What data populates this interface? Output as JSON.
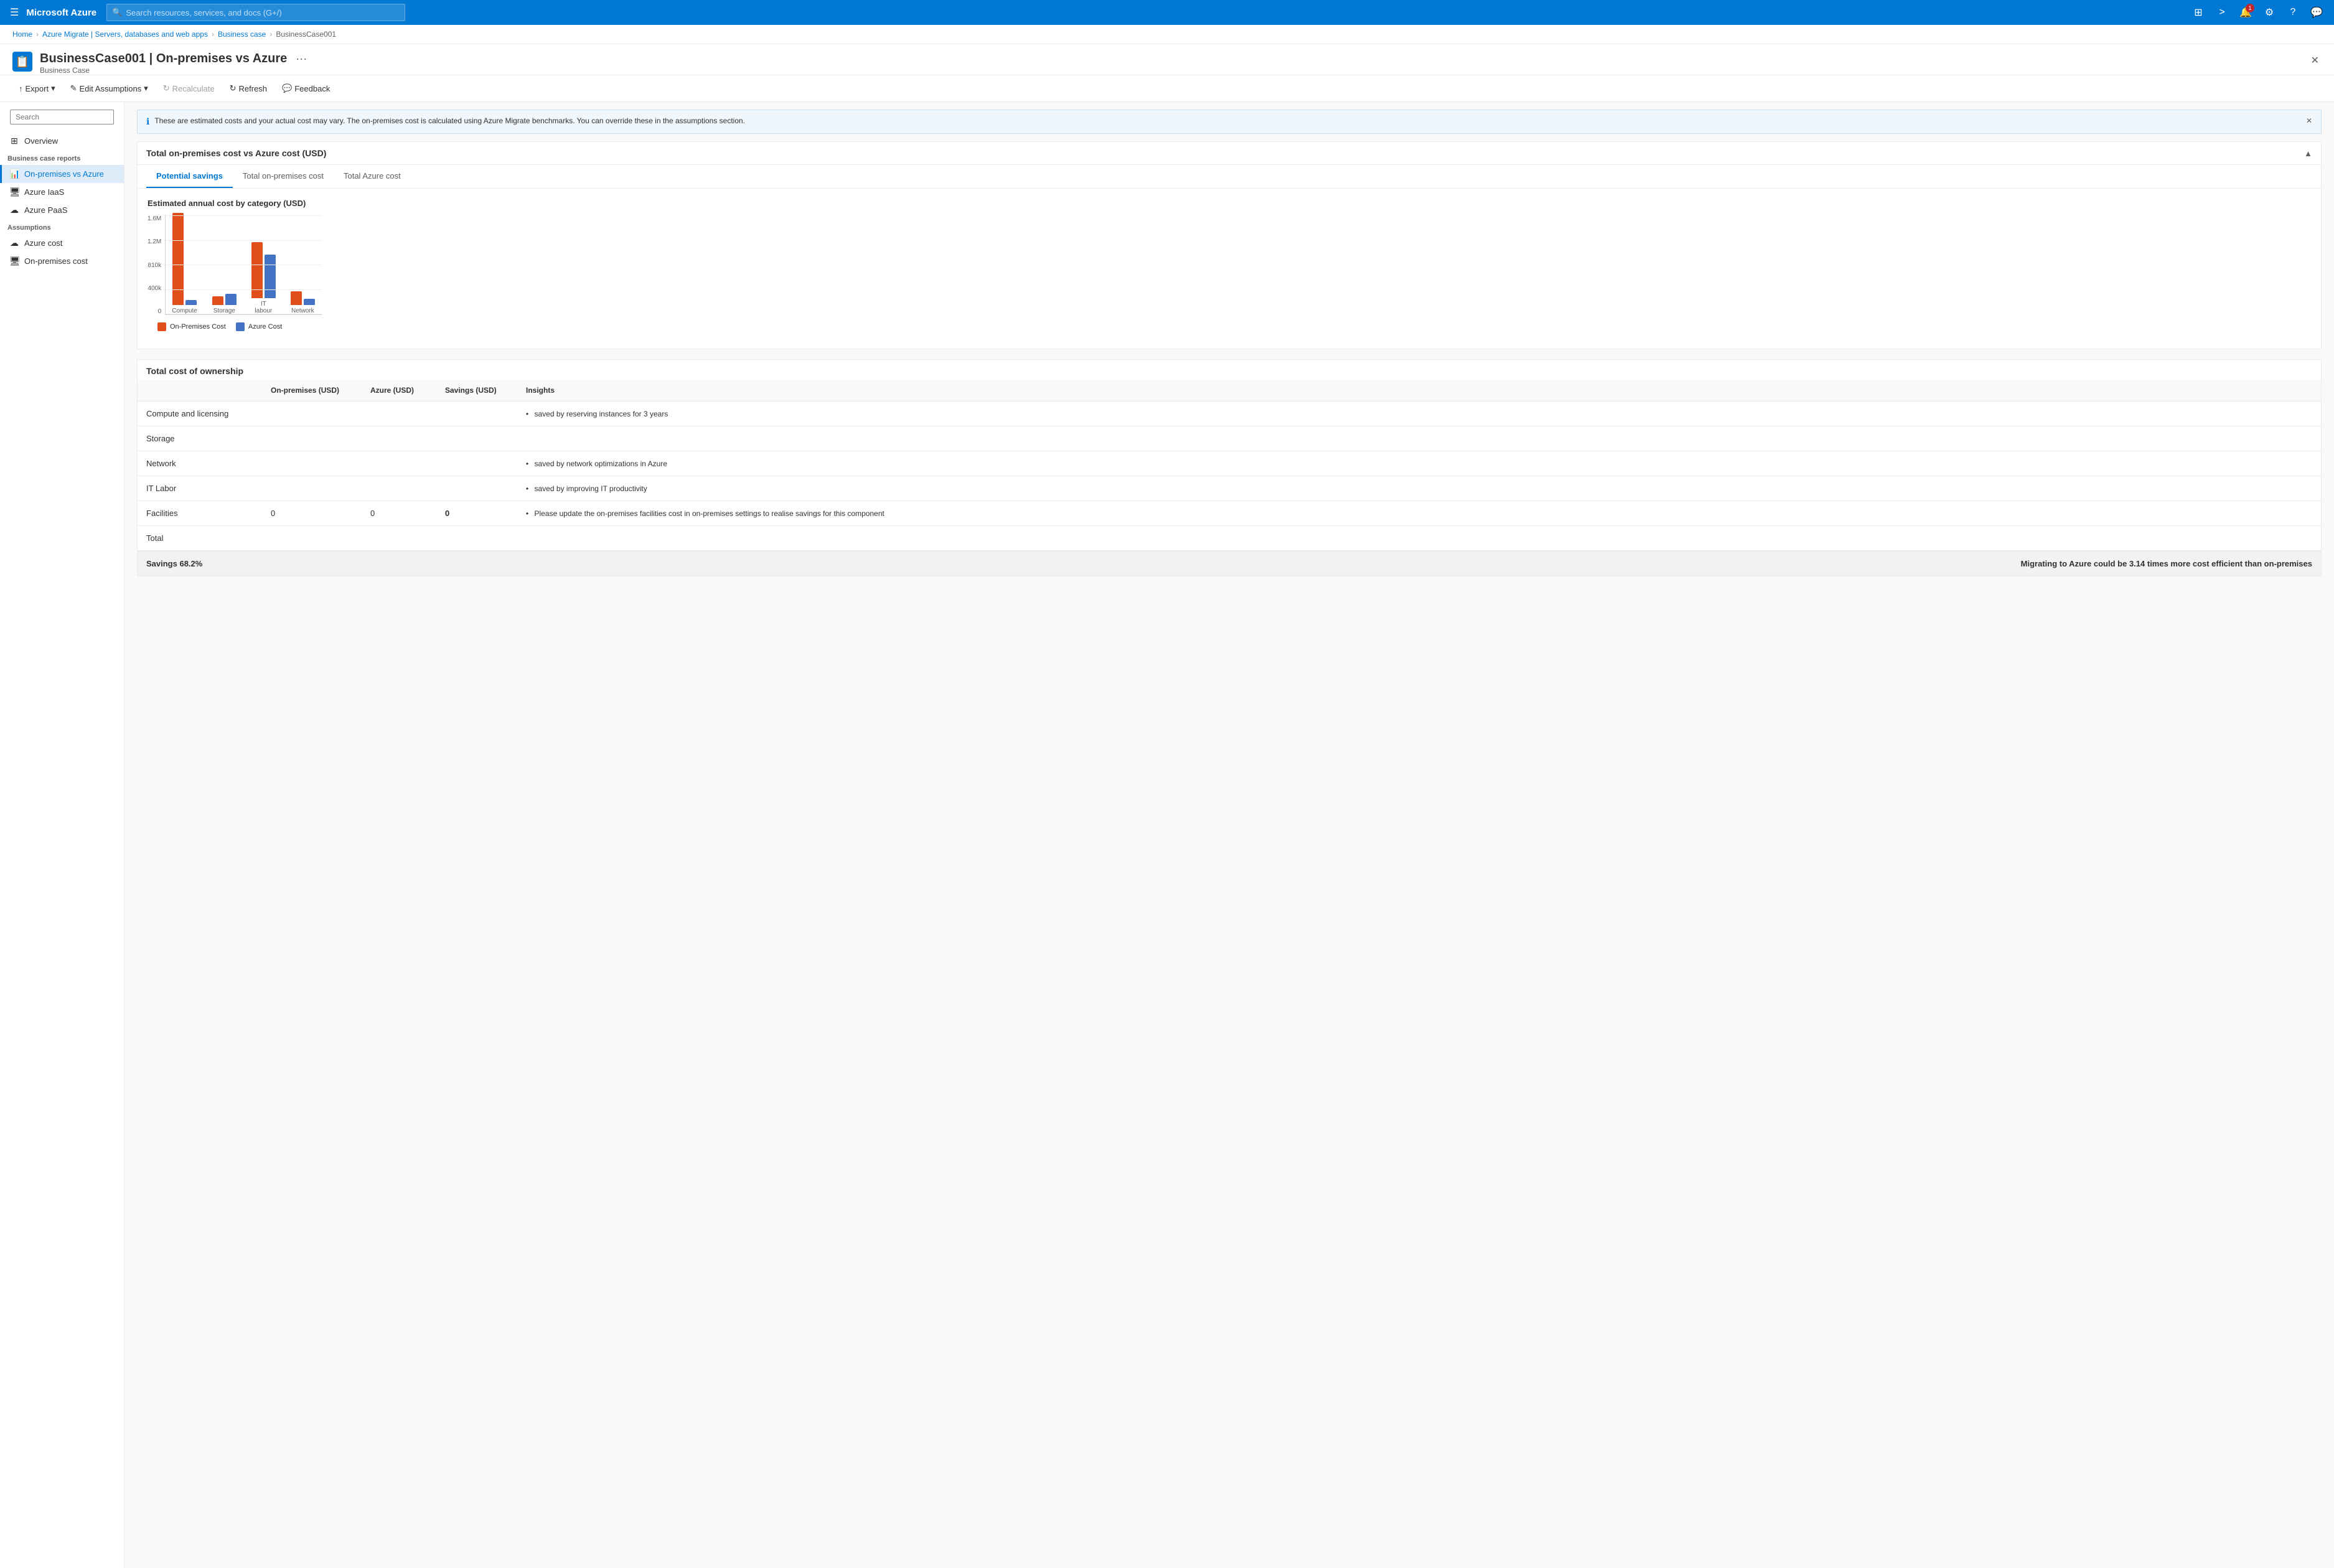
{
  "app": {
    "name": "Microsoft Azure"
  },
  "topnav": {
    "search_placeholder": "Search resources, services, and docs (G+/)",
    "icons": [
      "portal",
      "cloud-shell",
      "notifications",
      "settings",
      "help",
      "feedback"
    ]
  },
  "breadcrumb": {
    "items": [
      "Home",
      "Azure Migrate | Servers, databases and web apps",
      "Business case",
      "BusinessCase001"
    ]
  },
  "page": {
    "icon": "📋",
    "title": "BusinessCase001 | On-premises vs Azure",
    "subtitle": "Business Case"
  },
  "toolbar": {
    "export_label": "Export",
    "edit_assumptions_label": "Edit Assumptions",
    "recalculate_label": "Recalculate",
    "refresh_label": "Refresh",
    "feedback_label": "Feedback"
  },
  "info_banner": {
    "text": "These are estimated costs and your actual cost may vary. The on-premises cost is calculated using Azure Migrate benchmarks. You can override these in the assumptions section."
  },
  "section_title": "Total on-premises cost vs Azure cost (USD)",
  "tabs": {
    "items": [
      "Potential savings",
      "Total on-premises cost",
      "Total Azure cost"
    ]
  },
  "chart": {
    "title": "Estimated annual cost by category (USD)",
    "y_labels": [
      "1.6M",
      "1.2M",
      "810k",
      "400k",
      "0"
    ],
    "bar_groups": [
      {
        "label": "Compute",
        "on_prem_height": 148,
        "azure_height": 8
      },
      {
        "label": "Storage",
        "on_prem_height": 14,
        "azure_height": 18
      },
      {
        "label": "IT\nlabour",
        "label_display": "IT labour",
        "on_prem_height": 90,
        "azure_height": 70
      },
      {
        "label": "Network",
        "on_prem_height": 22,
        "azure_height": 10
      }
    ],
    "legend": {
      "on_prem_label": "On-Premises Cost",
      "azure_label": "Azure Cost"
    }
  },
  "tco": {
    "title": "Total cost of ownership",
    "headers": [
      "",
      "On-premises (USD)",
      "Azure (USD)",
      "Savings (USD)",
      "Insights"
    ],
    "rows": [
      {
        "name": "Compute and licensing",
        "on_prem": "",
        "azure": "",
        "savings": "",
        "insight": "saved by reserving instances for 3 years"
      },
      {
        "name": "Storage",
        "on_prem": "",
        "azure": "",
        "savings": "",
        "insight": ""
      },
      {
        "name": "Network",
        "on_prem": "",
        "azure": "",
        "savings": "",
        "insight": "saved by network optimizations in Azure"
      },
      {
        "name": "IT Labor",
        "on_prem": "",
        "azure": "",
        "savings": "",
        "insight": "saved by improving IT productivity"
      },
      {
        "name": "Facilities",
        "on_prem": "0",
        "azure": "0",
        "savings": "0",
        "insight": "Please update the on-premises facilities cost in on-premises settings to realise savings for this component"
      },
      {
        "name": "Total",
        "on_prem": "",
        "azure": "",
        "savings": "",
        "insight": ""
      }
    ]
  },
  "savings_footer": {
    "left_text": "Savings 68.2%",
    "right_text": "Migrating to Azure could be 3.14 times more cost efficient than on-premises"
  },
  "sidebar": {
    "search_placeholder": "Search",
    "overview_label": "Overview",
    "reports_section": "Business case reports",
    "reports": [
      {
        "label": "On-premises vs Azure",
        "icon": "📊",
        "active": true
      },
      {
        "label": "Azure IaaS",
        "icon": "🖥",
        "active": false
      },
      {
        "label": "Azure PaaS",
        "icon": "☁",
        "active": false
      }
    ],
    "assumptions_section": "Assumptions",
    "assumptions": [
      {
        "label": "Azure cost",
        "icon": "☁",
        "active": false
      },
      {
        "label": "On-premises cost",
        "icon": "🖥",
        "active": false
      }
    ]
  }
}
